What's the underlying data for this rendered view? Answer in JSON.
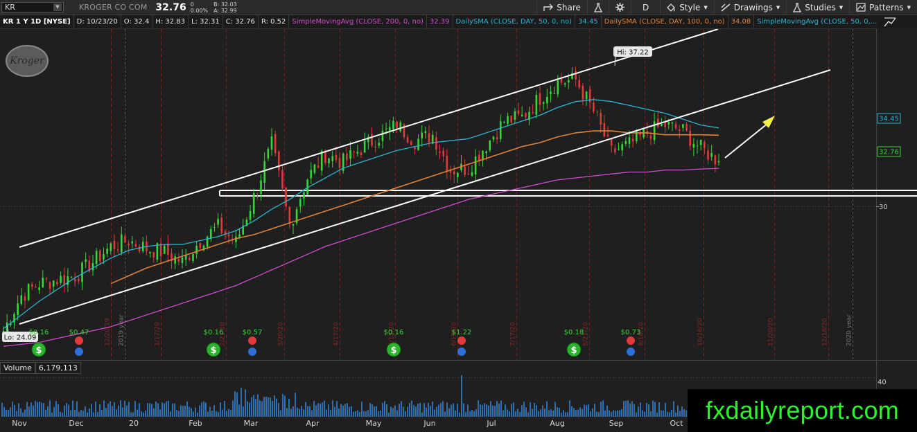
{
  "toolbar": {
    "symbol": "KR",
    "company": "KROGER CO COM",
    "last": "32.76",
    "change": "0",
    "change_pct": "0.00%",
    "bid": "B: 32.03",
    "ask": "A: 32.99",
    "buttons": {
      "share": "Share",
      "interval": "D",
      "style": "Style",
      "drawings": "Drawings",
      "studies": "Studies",
      "patterns": "Patterns"
    }
  },
  "studybar": {
    "title": "KR 1 Y 1D [NYSE]",
    "date": "D: 10/23/20",
    "open": "O: 32.4",
    "high": "H: 32.83",
    "low": "L: 32.31",
    "close": "C: 32.76",
    "range": "R: 0.52",
    "studies": [
      {
        "label": "SimpleMovingAvg (CLOSE, 200, 0, no)",
        "value": "32.39",
        "color": "#d04cd0"
      },
      {
        "label": "DailySMA (CLOSE, DAY, 50, 0, no)",
        "value": "34.45",
        "color": "#28b5d0"
      },
      {
        "label": "DailySMA (CLOSE, DAY, 100, 0, no)",
        "value": "34.08",
        "color": "#e0833a"
      },
      {
        "label": "SimpleMovingAvg (CLOSE, 50, 0,...",
        "value": "",
        "color": "#28b5d0"
      }
    ]
  },
  "logo_text": "Kroger",
  "volume": {
    "label": "Volume",
    "value": "6,179,113"
  },
  "price_axis": {
    "tag_sma50": "34.45",
    "tag_last": "32.76",
    "level_30": "30",
    "vol_40": "40"
  },
  "annotations": {
    "hi": "Hi: 37.22",
    "lo": "Lo: 24.09"
  },
  "events": [
    {
      "kind": "dividend",
      "label": "$0.16"
    },
    {
      "kind": "earnings",
      "label": "$0.47"
    },
    {
      "kind": "dividend",
      "label": "$0.16"
    },
    {
      "kind": "earnings",
      "label": "$0.57"
    },
    {
      "kind": "dividend",
      "label": "$0.16"
    },
    {
      "kind": "earnings",
      "label": "$1.22"
    },
    {
      "kind": "dividend",
      "label": "$0.18"
    },
    {
      "kind": "earnings",
      "label": "$0.73"
    }
  ],
  "vertical_dates": [
    "12/20/19",
    "2019 year",
    "1/17/20",
    "2/21/20",
    "3/20/20",
    "4/17/20",
    "5/15/20",
    "6/19/20",
    "7/17/20",
    "8/21/20",
    "9/18/20",
    "10/16/20",
    "11/20/20",
    "12/18/20",
    "2020 year"
  ],
  "watermark": "fxdailyreport.com",
  "colors": {
    "sma200": "#d04cd0",
    "sma50": "#28b5d0",
    "sma100": "#e0833a",
    "up": "#39d639",
    "down": "#e03a3a",
    "bg": "#1f1f1f"
  },
  "chart_data": {
    "type": "candlestick",
    "symbol": "KR",
    "x_tick_labels": [
      "Nov",
      "Dec",
      "20",
      "Feb",
      "Mar",
      "Apr",
      "May",
      "Jun",
      "Jul",
      "Aug",
      "Sep",
      "Oct"
    ],
    "y_tick_labels": [
      "30"
    ],
    "ylim": [
      22.6,
      39.5
    ],
    "closes": [
      24.1,
      25.9,
      26.5,
      26.7,
      26.9,
      27.6,
      28.4,
      28.7,
      28.3,
      28.1,
      27.6,
      28.7,
      29.4,
      28.6,
      30.9,
      33.6,
      29.5,
      31.9,
      33.1,
      32.7,
      33.4,
      34.0,
      34.6,
      33.8,
      34.1,
      32.3,
      32.4,
      33.6,
      34.8,
      35.0,
      36.0,
      36.8,
      36.9,
      35.3,
      33.2,
      33.6,
      34.2,
      34.6,
      34.3,
      33.4,
      32.76
    ],
    "hi": 37.22,
    "lo": 24.09,
    "sma50": [
      24.2,
      24.9,
      25.6,
      26.2,
      26.8,
      27.3,
      27.8,
      28.2,
      28.4,
      28.5,
      28.5,
      28.7,
      28.9,
      29.2,
      29.7,
      30.3,
      30.8,
      31.4,
      31.9,
      32.4,
      32.7,
      33.0,
      33.3,
      33.5,
      33.7,
      33.8,
      33.9,
      34.2,
      34.5,
      34.8,
      35.1,
      35.5,
      35.8,
      35.9,
      35.8,
      35.6,
      35.4,
      35.2,
      34.9,
      34.6,
      34.45
    ],
    "sma100": [
      null,
      null,
      null,
      null,
      null,
      null,
      26.5,
      26.9,
      27.3,
      27.6,
      27.9,
      28.2,
      28.5,
      28.8,
      29.0,
      29.3,
      29.6,
      29.9,
      30.2,
      30.5,
      30.8,
      31.1,
      31.4,
      31.7,
      32.0,
      32.3,
      32.6,
      32.9,
      33.2,
      33.5,
      33.7,
      34.0,
      34.2,
      34.3,
      34.3,
      34.2,
      34.2,
      34.1,
      34.1,
      34.1,
      34.08
    ],
    "sma200": [
      23.3,
      23.4,
      23.5,
      23.7,
      23.9,
      24.1,
      24.3,
      24.6,
      24.9,
      25.2,
      25.5,
      25.8,
      26.1,
      26.4,
      26.8,
      27.2,
      27.6,
      28.0,
      28.4,
      28.7,
      29.0,
      29.3,
      29.6,
      29.9,
      30.2,
      30.5,
      30.8,
      31.0,
      31.2,
      31.4,
      31.6,
      31.8,
      31.9,
      32.0,
      32.1,
      32.2,
      32.2,
      32.3,
      32.3,
      32.35,
      32.39
    ]
  }
}
